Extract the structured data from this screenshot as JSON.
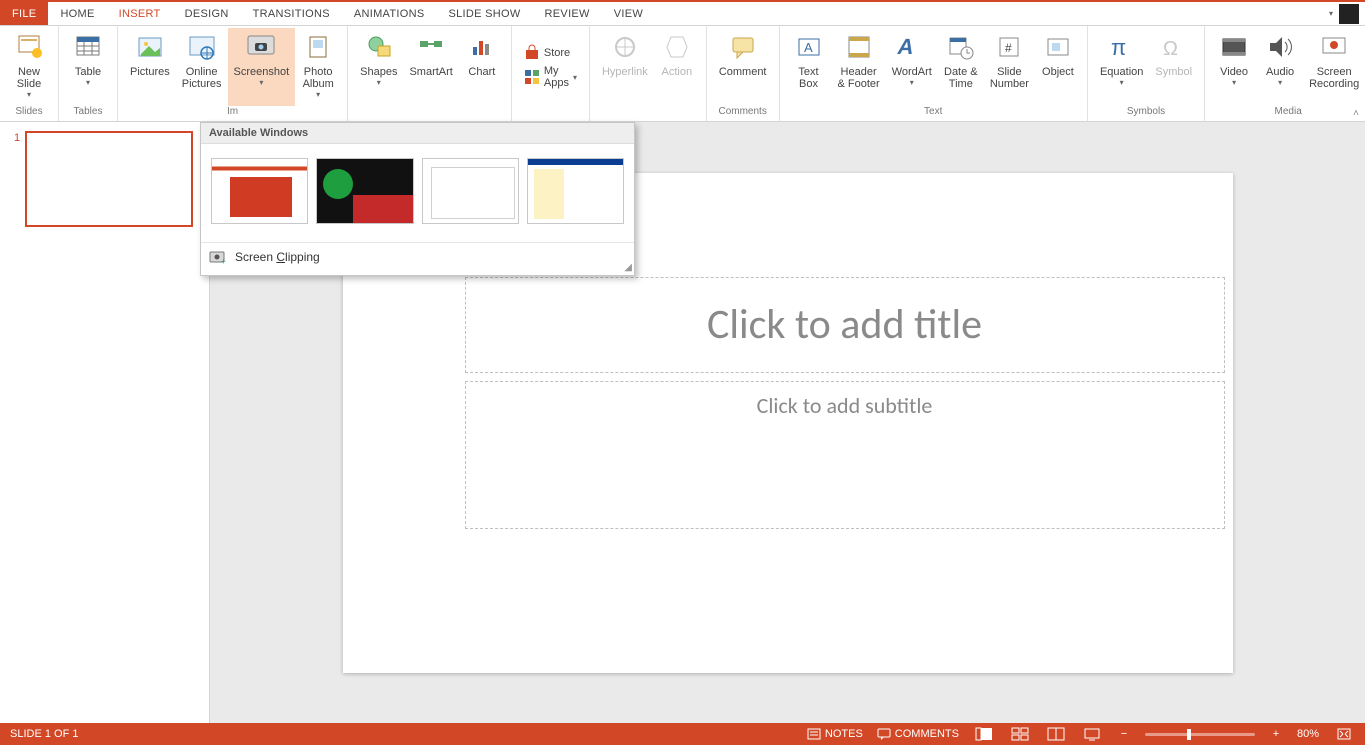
{
  "tabs": {
    "file": "FILE",
    "home": "HOME",
    "insert": "INSERT",
    "design": "DESIGN",
    "transitions": "TRANSITIONS",
    "animations": "ANIMATIONS",
    "slideshow": "SLIDE SHOW",
    "review": "REVIEW",
    "view": "VIEW"
  },
  "user_name": "",
  "ribbon": {
    "groups": {
      "slides": "Slides",
      "tables": "Tables",
      "images": "Im",
      "illustrations": "",
      "apps": "",
      "links": "",
      "comments": "Comments",
      "text": "Text",
      "symbols": "Symbols",
      "media": "Media"
    },
    "buttons": {
      "new_slide": "New\nSlide",
      "table": "Table",
      "pictures": "Pictures",
      "online_pictures": "Online\nPictures",
      "screenshot": "Screenshot",
      "photo_album": "Photo\nAlbum",
      "shapes": "Shapes",
      "smartart": "SmartArt",
      "chart": "Chart",
      "store": "Store",
      "my_apps": "My Apps",
      "hyperlink": "Hyperlink",
      "action": "Action",
      "comment": "Comment",
      "text_box": "Text\nBox",
      "header_footer": "Header\n& Footer",
      "wordart": "WordArt",
      "date_time": "Date &\nTime",
      "slide_number": "Slide\nNumber",
      "object": "Object",
      "equation": "Equation",
      "symbol": "Symbol",
      "video": "Video",
      "audio": "Audio",
      "screen_recording": "Screen\nRecording"
    }
  },
  "screenshot_dropdown": {
    "header": "Available Windows",
    "clip_label": "Screen ",
    "clip_underlined": "C",
    "clip_rest": "lipping"
  },
  "slide": {
    "title_placeholder": "Click to add title",
    "subtitle_placeholder": "Click to add subtitle"
  },
  "thumbs": {
    "n1": "1"
  },
  "status": {
    "slide_of": "SLIDE 1 OF 1",
    "notes": "NOTES",
    "comments": "COMMENTS",
    "zoom": "80%"
  }
}
